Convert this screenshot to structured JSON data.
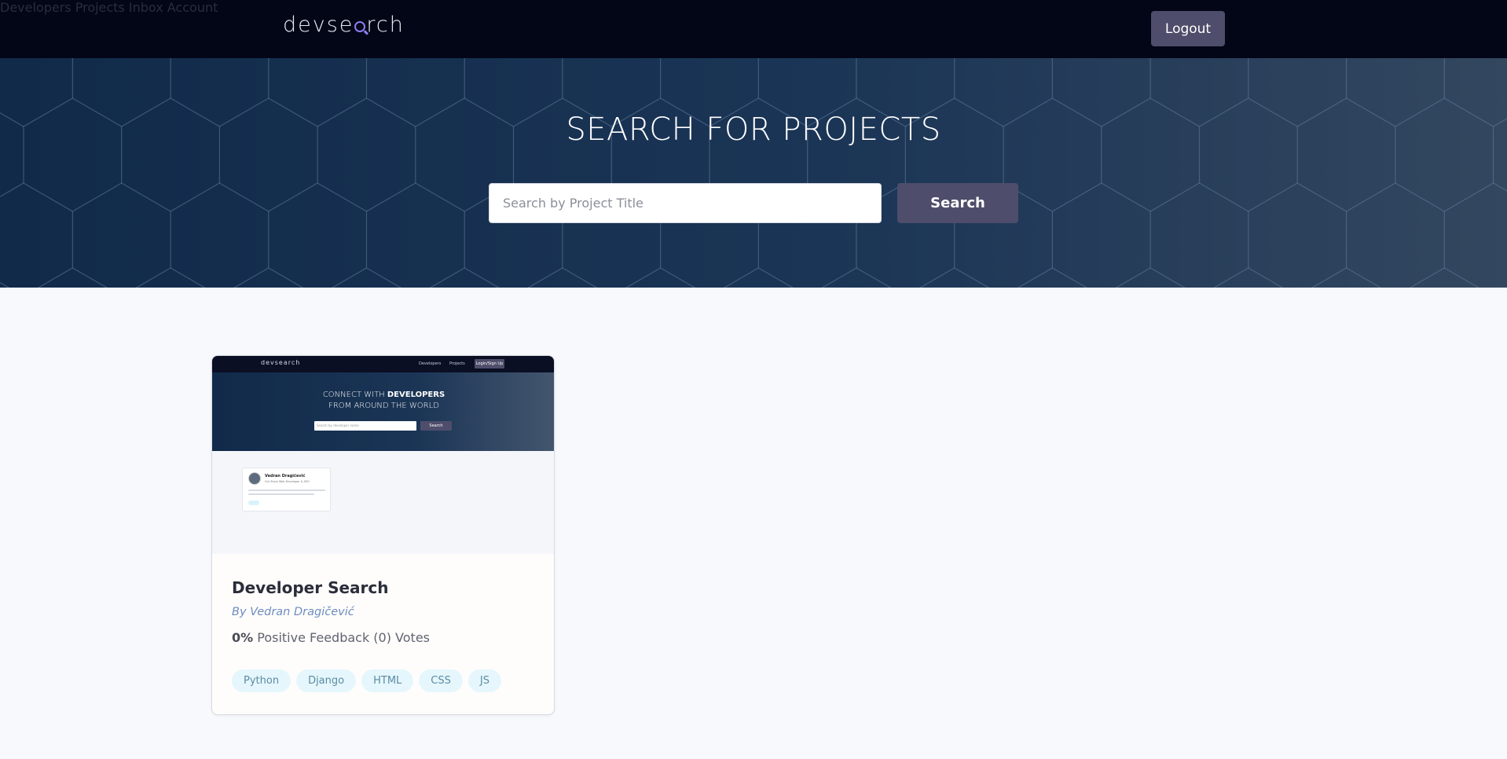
{
  "header": {
    "logo_left": "devse",
    "logo_right": "rch",
    "nav": [
      {
        "label": "Developers"
      },
      {
        "label": "Projects"
      },
      {
        "label": "Inbox"
      },
      {
        "label": "Account"
      }
    ],
    "logout_label": "Logout"
  },
  "hero": {
    "title": "SEARCH FOR PROJECTS",
    "search_placeholder": "Search by Project Title",
    "search_button": "Search"
  },
  "projects": [
    {
      "title": "Developer Search",
      "author": "By Vedran Dragičević",
      "feedback_percent": "0%",
      "feedback_text": " Positive Feedback (0) Votes",
      "tags": [
        "Python",
        "Django",
        "HTML",
        "CSS",
        "JS"
      ],
      "thumbnail": {
        "logo": "devsearch",
        "nav": [
          "Developers",
          "Projects"
        ],
        "login": "Login/Sign Up",
        "hero_line1": "CONNECT WITH ",
        "hero_bold": "DEVELOPERS",
        "hero_line2": "FROM AROUND THE WORLD",
        "search_placeholder": "Search by developer name",
        "search_button": "Search",
        "dev_name": "Vedran Dragičević",
        "dev_role": "Full Stack Web Developer & SEO"
      }
    }
  ],
  "colors": {
    "header_bg": "#020617",
    "accent_button": "#4e4d6b",
    "hero_bg": "#1b3556",
    "tag_bg": "#e5f7fc",
    "author_text": "#6c8cc0"
  }
}
